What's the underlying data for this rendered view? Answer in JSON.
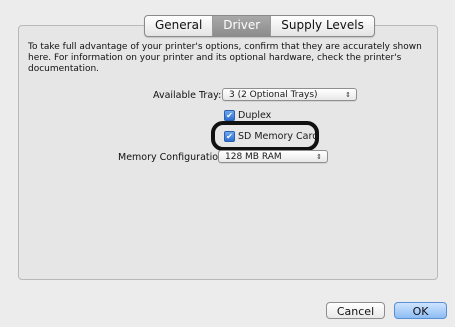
{
  "tabs": [
    {
      "label": "General",
      "selected": false
    },
    {
      "label": "Driver",
      "selected": true
    },
    {
      "label": "Supply Levels",
      "selected": false
    }
  ],
  "description": "To take full advantage of your printer's options, confirm that they are accurately shown here. For information on your printer and its optional hardware, check the printer's documentation.",
  "available_tray": {
    "label": "Available Tray:",
    "value": "3 (2 Optional Trays)"
  },
  "duplex": {
    "label": "Duplex",
    "checked": true
  },
  "sd_memory_card": {
    "label": "SD Memory Card",
    "checked": true
  },
  "memory_configuration": {
    "label": "Memory Configuration:",
    "value": "128 MB RAM"
  },
  "buttons": {
    "cancel": "Cancel",
    "ok": "OK"
  },
  "icons": {
    "popup_arrows": "⇕",
    "checkmark": "✔"
  },
  "colors": {
    "selected_tab": "#999999",
    "default_button": "#8dbcf3",
    "highlight_ring": "#111111"
  }
}
